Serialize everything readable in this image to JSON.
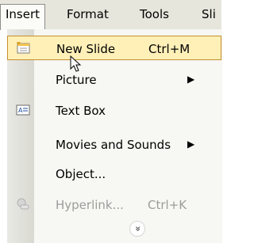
{
  "menubar": {
    "items": [
      {
        "label": "Insert"
      },
      {
        "label": "Format"
      },
      {
        "label": "Tools"
      },
      {
        "label": "Sli"
      }
    ]
  },
  "menu": {
    "items": [
      {
        "label": "New Slide",
        "shortcut": "Ctrl+M"
      },
      {
        "label": "Picture"
      },
      {
        "label": "Text Box"
      },
      {
        "label": "Movies and Sounds"
      },
      {
        "label": "Object..."
      },
      {
        "label": "Hyperlink...",
        "shortcut": "Ctrl+K"
      }
    ],
    "expand_glyph": "»"
  },
  "colors": {
    "menubar_bg": "#e6e6dd",
    "highlight_bg": "#fff0b8",
    "highlight_border": "#c48e2c",
    "disabled_text": "#9c9c9c"
  },
  "icons": [
    "new-slide-icon",
    "text-box-icon",
    "hyperlink-icon",
    "submenu-arrow-icon",
    "expand-chevron-icon",
    "mouse-cursor-icon"
  ]
}
